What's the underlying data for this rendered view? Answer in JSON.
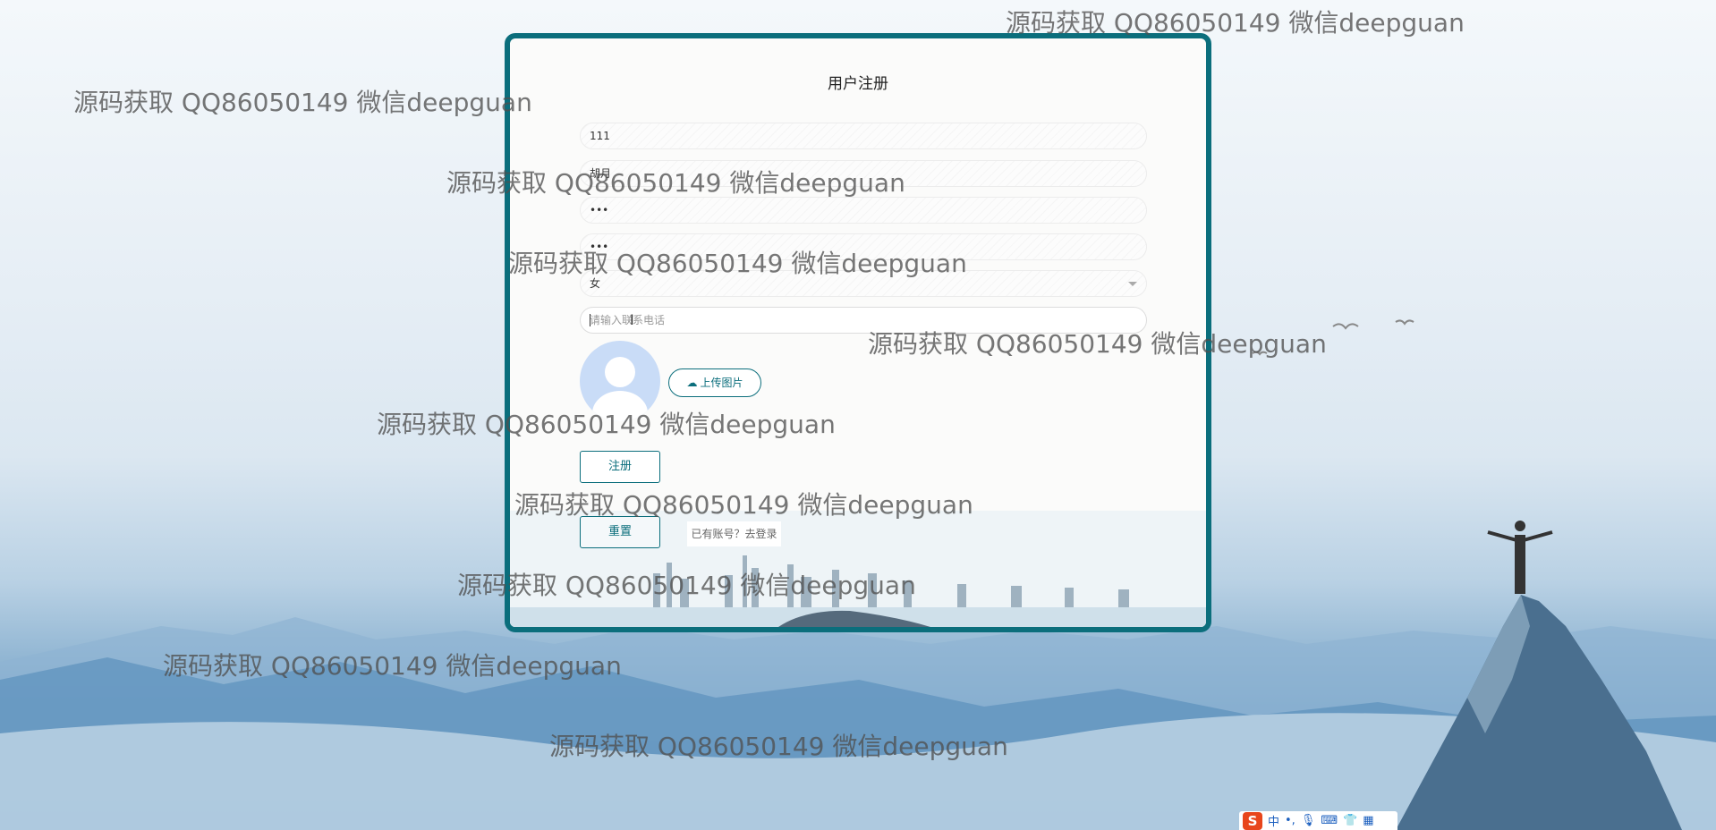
{
  "form": {
    "title": "用户注册",
    "account_value": "111",
    "name_value": "胡月",
    "password_value": "•••",
    "confirm_password_value": "•••",
    "gender_value": "女",
    "phone_placeholder": "请输入联系电话",
    "upload_label": "上传图片",
    "register_label": "注册",
    "reset_label": "重置",
    "login_link": "已有账号？去登录"
  },
  "watermark": "源码获取 QQ86050149 微信deepguan",
  "ime": {
    "logo": "S",
    "mode": "中",
    "icons": [
      "punctuation-icon",
      "microphone-icon",
      "keyboard-icon",
      "skin-icon",
      "toolbox-icon"
    ]
  },
  "colors": {
    "accent": "#0b6e7c",
    "avatar": "#c9dcf7"
  }
}
